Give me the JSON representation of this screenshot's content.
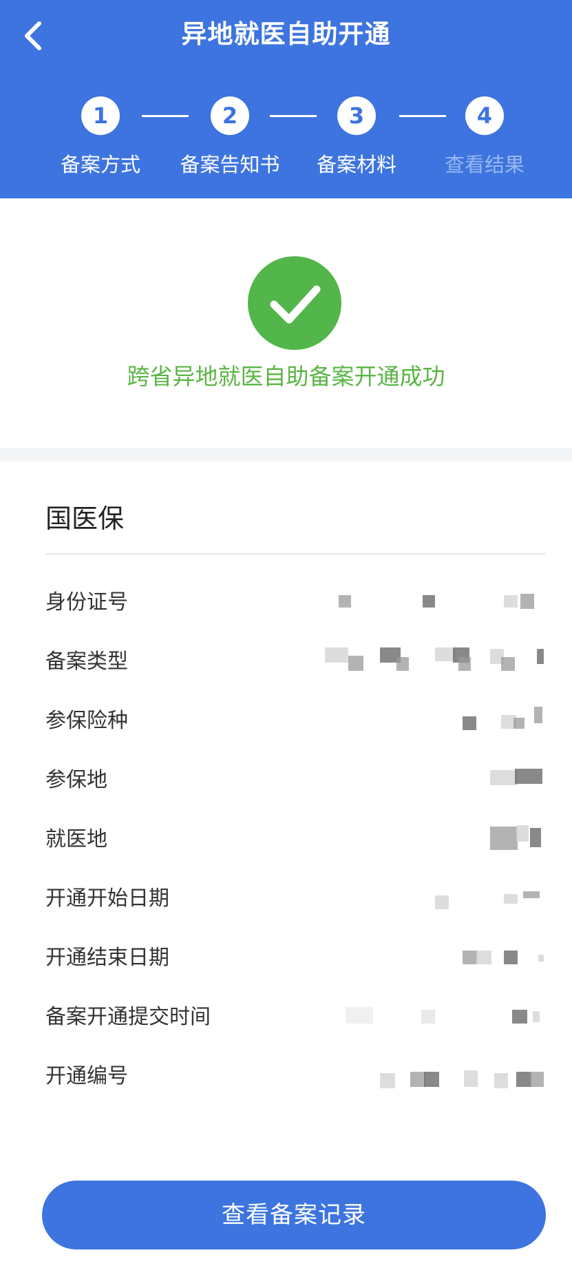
{
  "header": {
    "back_icon": "chevron-left-icon",
    "title": "异地就医自助开通",
    "background": "#3d74df"
  },
  "steps": [
    {
      "number": "1",
      "label": "备案方式",
      "active": true
    },
    {
      "number": "2",
      "label": "备案告知书",
      "active": true
    },
    {
      "number": "3",
      "label": "备案材料",
      "active": true
    },
    {
      "number": "4",
      "label": "查看结果",
      "active": false
    }
  ],
  "result": {
    "icon": "check-circle-icon",
    "color": "#52b64a",
    "message": "跨省异地就医自助备案开通成功"
  },
  "info": {
    "section_title": "国医保",
    "rows": [
      {
        "label": "身份证号",
        "value_state": "pixelated"
      },
      {
        "label": "备案类型",
        "value_state": "pixelated"
      },
      {
        "label": "参保险种",
        "value_state": "pixelated"
      },
      {
        "label": "参保地",
        "value_state": "pixelated"
      },
      {
        "label": "就医地",
        "value_state": "pixelated"
      },
      {
        "label": "开通开始日期",
        "value_state": "pixelated"
      },
      {
        "label": "开通结束日期",
        "value_state": "pixelated"
      },
      {
        "label": "备案开通提交时间",
        "value_state": "pixelated"
      },
      {
        "label": "开通编号",
        "value_state": "pixelated"
      }
    ]
  },
  "actions": {
    "view_records_label": "查看备案记录"
  }
}
